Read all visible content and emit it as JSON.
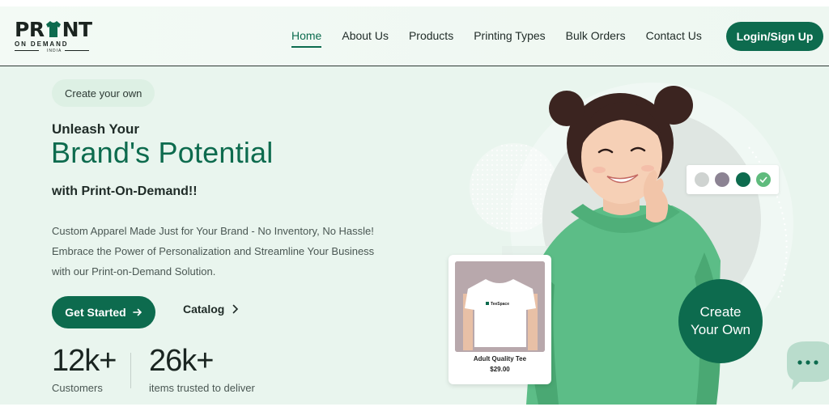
{
  "brand": {
    "logo_word_left": "PR",
    "logo_word_right": "NT",
    "logo_sub": "ON DEMAND",
    "logo_country": "INDIA"
  },
  "nav": {
    "items": [
      {
        "label": "Home",
        "active": true
      },
      {
        "label": "About Us",
        "active": false
      },
      {
        "label": "Products",
        "active": false
      },
      {
        "label": "Printing Types",
        "active": false
      },
      {
        "label": "Bulk Orders",
        "active": false
      },
      {
        "label": "Contact Us",
        "active": false
      }
    ],
    "login_label": "Login/Sign Up"
  },
  "hero": {
    "chip": "Create your own",
    "title_small": "Unleash Your",
    "title_large": "Brand's Potential",
    "subtitle": "with Print-On-Demand!!",
    "description_lines": [
      "Custom Apparel Made Just for Your Brand - No Inventory, No Hassle!",
      "Embrace the Power of Personalization and Streamline Your Business",
      "with our Print-on-Demand Solution."
    ],
    "cta_primary": "Get Started",
    "cta_secondary": "Catalog"
  },
  "stats": [
    {
      "value": "12k+",
      "label": "Customers"
    },
    {
      "value": "26k+",
      "label": "items trusted to deliver"
    }
  ],
  "product_card": {
    "shirt_brand": "TeeSpace",
    "name": "Adult Quality Tee",
    "price": "$29.00"
  },
  "color_swatches": [
    "#cfd3d1",
    "#8c8393",
    "#0d6b4e",
    "#5fbb7d"
  ],
  "badge": {
    "line1": "Create",
    "line2": "Your Own"
  },
  "icons": {
    "chat": "chat-bubble-icon",
    "arrow": "arrow-right-icon",
    "chevron": "chevron-right-icon",
    "check": "check-icon"
  },
  "colors": {
    "brand_green": "#0d6b4e",
    "background": "#e9f5ee",
    "hoodie": "#5cbd87"
  }
}
